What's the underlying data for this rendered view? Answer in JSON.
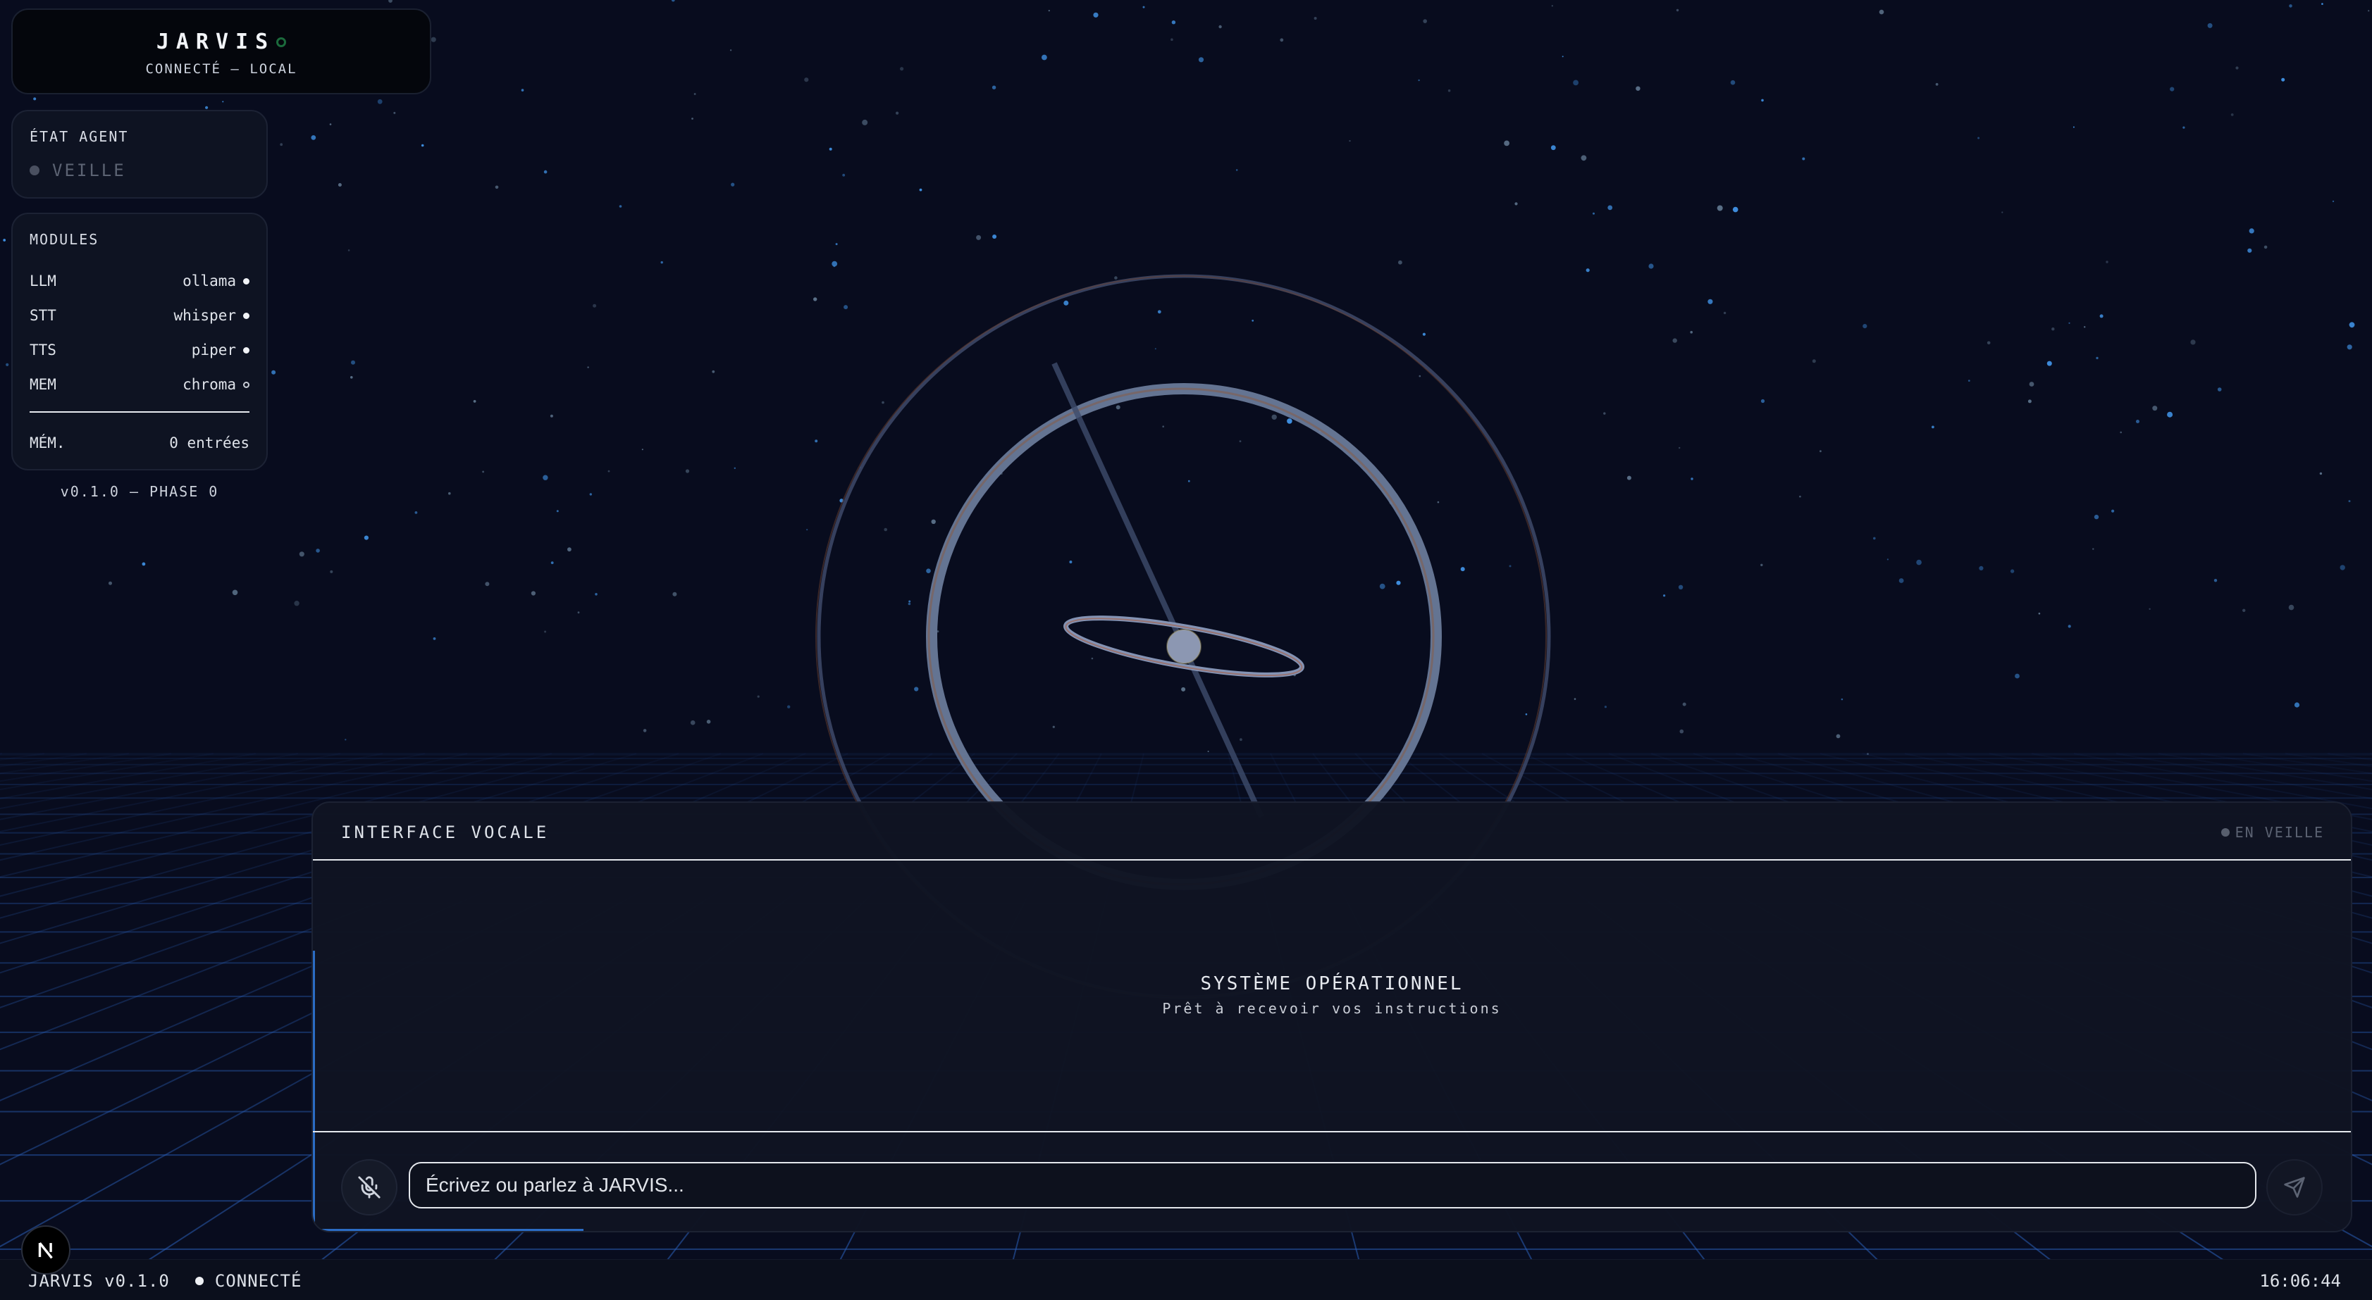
{
  "brand": {
    "title": "JARVIS",
    "subtitle": "CONNECTÉ — LOCAL"
  },
  "agent": {
    "heading": "ÉTAT AGENT",
    "state": "VEILLE"
  },
  "modules": {
    "heading": "MODULES",
    "items": [
      {
        "key": "LLM",
        "value": "ollama",
        "active": true
      },
      {
        "key": "STT",
        "value": "whisper",
        "active": true
      },
      {
        "key": "TTS",
        "value": "piper",
        "active": true
      },
      {
        "key": "MEM",
        "value": "chroma",
        "active": false
      }
    ],
    "memory_label": "MÉM.",
    "memory_value": "0 entrées"
  },
  "version_line": "v0.1.0 — PHASE 0",
  "voice": {
    "heading": "INTERFACE VOCALE",
    "status": "EN VEILLE",
    "message_title": "SYSTÈME OPÉRATIONNEL",
    "message_subtitle": "Prêt à recevoir vos instructions",
    "input_placeholder": "Écrivez ou parlez à JARVIS..."
  },
  "statusbar": {
    "app": "JARVIS v0.1.0",
    "connection": "CONNECTÉ",
    "time": "16:06:44"
  },
  "icons": {
    "mic": "mic-off-icon",
    "send": "send-icon",
    "badge": "nextjs-logo-icon"
  },
  "colors": {
    "background": "#080c1e",
    "accent": "#2b6cc4",
    "panel": "#0e1322"
  }
}
